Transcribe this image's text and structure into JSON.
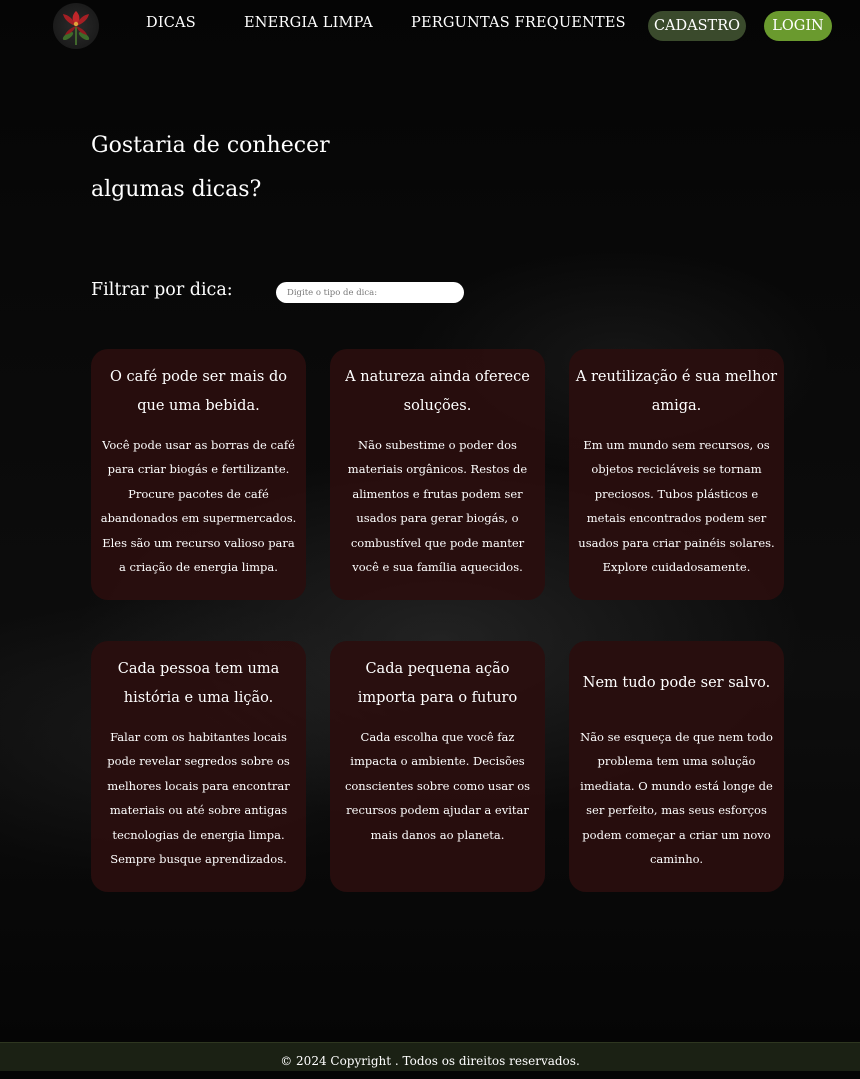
{
  "nav": {
    "logo_icon": "red-flower-logo-icon",
    "links": [
      "DICAS",
      "ENERGIA LIMPA",
      "PERGUNTAS FREQUENTES"
    ],
    "cadastro_label": "CADASTRO",
    "login_label": "LOGIN"
  },
  "colors": {
    "background": "#050505",
    "card": "#2a0e0e",
    "cadastro_button": "#3a4a2c",
    "login_button": "#6a9a2e",
    "footer": "#1b2114"
  },
  "hero": {
    "title_line1": "Gostaria de conhecer",
    "title_line2": "algumas dicas?"
  },
  "filter": {
    "label": "Filtrar por dica:",
    "placeholder": "Digite o tipo de dica:",
    "value": ""
  },
  "cards": [
    {
      "title": "O café pode ser mais do que uma bebida.",
      "text": "Você pode usar as borras de café para criar biogás e fertilizante. Procure pacotes de café abandonados em supermercados. Eles são um recurso valioso para a criação de energia limpa."
    },
    {
      "title": "A natureza ainda oferece soluções.",
      "text": "Não subestime o poder dos materiais orgânicos. Restos de alimentos e frutas podem ser usados para gerar biogás, o combustível que pode manter você e sua família aquecidos."
    },
    {
      "title": "A reutilização é sua melhor amiga.",
      "text": "Em um mundo sem recursos, os objetos recicláveis se tornam preciosos. Tubos plásticos e metais encontrados podem ser usados para criar painéis solares. Explore cuidadosamente."
    },
    {
      "title": "Cada pessoa tem uma história e uma lição.",
      "text": "Falar com os habitantes locais pode revelar segredos sobre os melhores locais para encontrar materiais ou até sobre antigas tecnologias de energia limpa. Sempre busque aprendizados."
    },
    {
      "title": "Cada pequena ação importa para o futuro",
      "text": "Cada escolha que você faz impacta o ambiente. Decisões conscientes sobre como usar os recursos podem ajudar a evitar mais danos ao planeta."
    },
    {
      "title": "Nem tudo pode ser salvo.",
      "text": "Não se esqueça de que nem todo problema tem uma solução imediata. O mundo está longe de ser perfeito, mas seus esforços podem começar a criar um novo caminho."
    }
  ],
  "footer": {
    "text": "© 2024 Copyright . Todos os direitos reservados."
  }
}
